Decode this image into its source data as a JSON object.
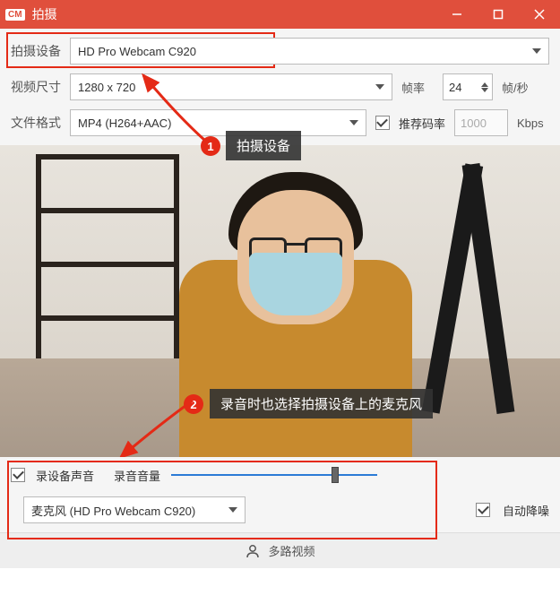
{
  "window": {
    "logo": "CM",
    "title": "拍摄"
  },
  "settings": {
    "device_label": "拍摄设备",
    "device_value": "HD Pro Webcam C920",
    "size_label": "视频尺寸",
    "size_value": "1280 x 720",
    "fps_label": "帧率",
    "fps_value": "24",
    "fps_unit": "帧/秒",
    "format_label": "文件格式",
    "format_value": "MP4 (H264+AAC)",
    "recommend_bitrate_label": "推荐码率",
    "bitrate_value": "1000",
    "bitrate_unit": "Kbps"
  },
  "callouts": {
    "badge1": "1",
    "text1": "拍摄设备",
    "badge2": "2",
    "text2": "录音时也选择拍摄设备上的麦克风"
  },
  "audio": {
    "record_device_audio_label": "录设备声音",
    "volume_label": "录音音量",
    "mic_value": "麦克风 (HD Pro Webcam C920)",
    "denoise_label": "自动降噪"
  },
  "footer": {
    "multiview": "多路视频"
  }
}
